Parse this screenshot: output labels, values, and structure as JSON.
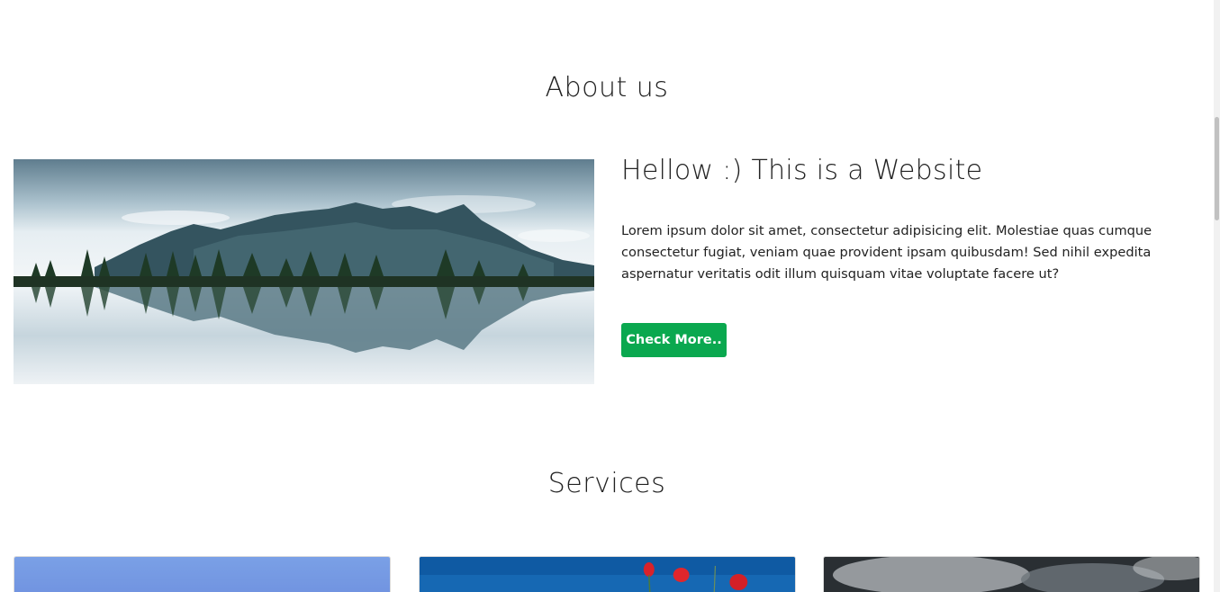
{
  "about": {
    "title": "About us",
    "heading": "Hellow :) This is a Website",
    "body": "Lorem ipsum dolor sit amet, consectetur adipisicing elit. Molestiae quas cumque consectetur fugiat, veniam quae provident ipsam quibusdam! Sed nihil expedita aspernatur veritatis odit illum quisquam vitae voluptate facere ut?",
    "button_label": "Check More..",
    "button_color": "#0aa84f"
  },
  "services": {
    "title": "Services"
  }
}
